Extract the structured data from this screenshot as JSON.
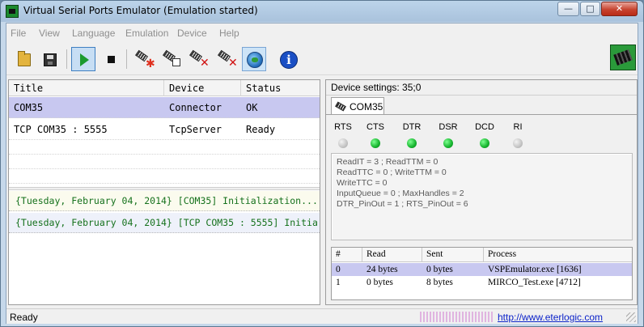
{
  "window": {
    "title": "Virtual Serial Ports Emulator (Emulation started)",
    "close_glyph": "✕",
    "minimize_glyph": "—",
    "maximize_glyph": "□"
  },
  "menu": [
    "File",
    "View",
    "Language",
    "Emulation",
    "Device",
    "Help"
  ],
  "toolbar": {
    "icons": [
      "open-folder-icon",
      "save-disk-icon",
      "play-icon",
      "stop-icon",
      "create-device-icon",
      "edit-device-icon",
      "delete-device-icon",
      "delete-all-devices-icon",
      "network-settings-icon",
      "info-icon",
      "vspe-logo-icon"
    ],
    "info_glyph": "i"
  },
  "ports_table": {
    "headers": [
      "Title",
      "Device",
      "Status"
    ],
    "rows": [
      {
        "title": "COM35",
        "device": "Connector",
        "status": "OK",
        "selected": true
      },
      {
        "title": "TCP COM35 : 5555",
        "device": "TcpServer",
        "status": "Ready",
        "selected": false
      }
    ]
  },
  "log": [
    "{Tuesday, February 04, 2014} [COM35] Initialization...",
    "{Tuesday, February 04, 2014} [TCP COM35 : 5555] Initia"
  ],
  "device_settings": {
    "title": "Device settings: 35;0",
    "tab_label": "COM35",
    "signals": [
      {
        "name": "RTS",
        "on": false
      },
      {
        "name": "CTS",
        "on": true
      },
      {
        "name": "DTR",
        "on": true
      },
      {
        "name": "DSR",
        "on": true
      },
      {
        "name": "DCD",
        "on": true
      },
      {
        "name": "RI",
        "on": false
      }
    ],
    "stats": [
      "ReadIT = 3 ; ReadTTM = 0",
      "ReadTTC = 0 ; WriteTTM = 0",
      "WriteTTC = 0",
      "InputQueue = 0 ; MaxHandles = 2",
      "DTR_PinOut = 1 ; RTS_PinOut = 6"
    ],
    "handles": {
      "headers": [
        "#",
        "Read",
        "Sent",
        "Process"
      ],
      "rows": [
        {
          "id": "0",
          "read": "24 bytes",
          "sent": "0 bytes",
          "process": "VSPEmulator.exe [1636]",
          "selected": true
        },
        {
          "id": "1",
          "read": "0 bytes",
          "sent": "8 bytes",
          "process": "MIRCO_Test.exe [4712]",
          "selected": false
        }
      ]
    }
  },
  "status_bar": {
    "text": "Ready",
    "link": "http://www.eterlogic.com"
  },
  "colors": {
    "selection": "#c8c8f0",
    "led_on": "#15b32d",
    "led_off": "#c4c4c4",
    "log_text": "#15711c",
    "link": "#0b22c9"
  }
}
